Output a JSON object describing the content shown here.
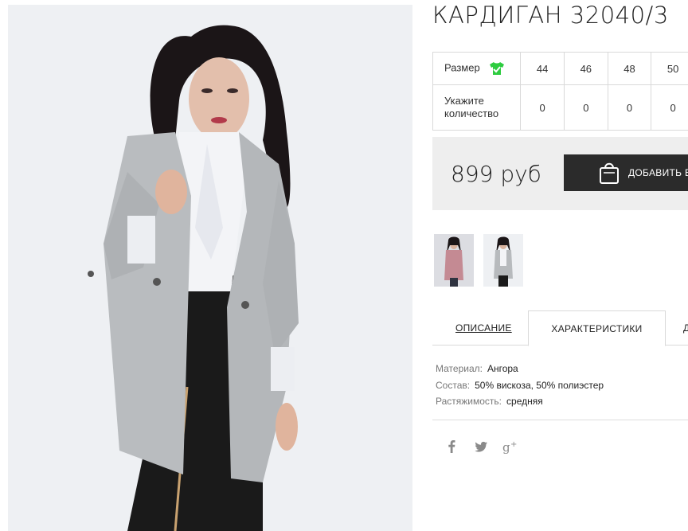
{
  "product": {
    "title": "КАРДИГАН 32040/3"
  },
  "sizes": {
    "size_label": "Размер",
    "size_icon": "tshirt-check-icon",
    "size_icon_color": "#2ecc40",
    "values": [
      "44",
      "46",
      "48",
      "50"
    ],
    "qty_label_line1": "Укажите",
    "qty_label_line2": "количество",
    "quantities": [
      "0",
      "0",
      "0",
      "0"
    ]
  },
  "purchase": {
    "price": "899 руб",
    "add_to_cart_label": "ДОБАВИТЬ В",
    "cart_icon": "shopping-bag-icon"
  },
  "tabs": {
    "description": "ОПИСАНИЕ",
    "characteristics": "ХАРАКТЕРИСТИКИ",
    "more": "Д"
  },
  "characteristics": [
    {
      "key": "Материал:",
      "value": "Ангора"
    },
    {
      "key": "Состав:",
      "value": "50% вискоза, 50% полиэстер"
    },
    {
      "key": "Растяжимость:",
      "value": "средняя"
    }
  ],
  "social": [
    "facebook-icon",
    "twitter-icon",
    "google-plus-icon"
  ],
  "colors": {
    "button_bg": "#2b2b2b",
    "price_bg": "#eeeeee",
    "photo_bg": "#eef0f3"
  }
}
